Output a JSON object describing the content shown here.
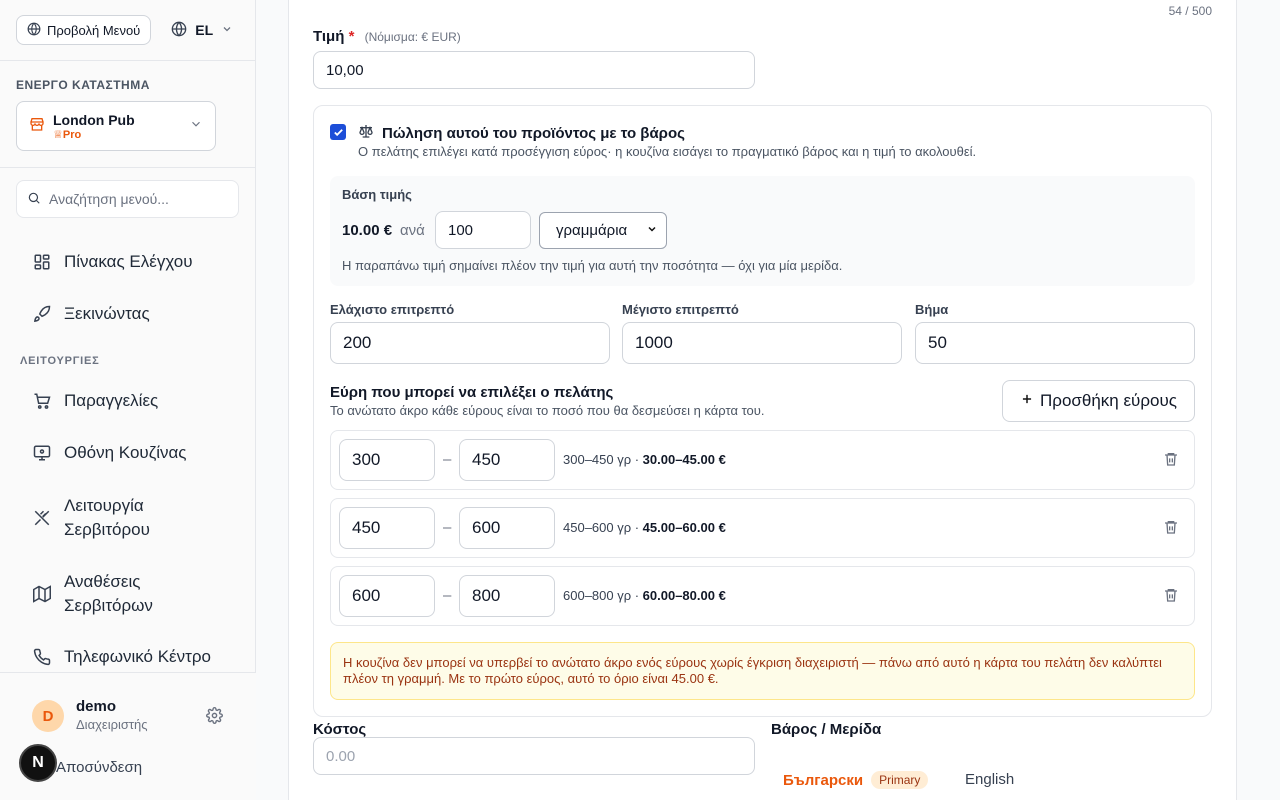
{
  "sidebar": {
    "menu_view_label": "Προβολή Μενού",
    "lang_code": "EL",
    "store_section_label": "ΕΝΕΡΓΟ ΚΑΤΑΣΤΗΜΑ",
    "store_name": "London Pub",
    "store_plan": "Pro",
    "search_placeholder": "Αναζήτηση μενού...",
    "nav": {
      "dashboard": "Πίνακας Ελέγχου",
      "getting_started": "Ξεκινώντας",
      "section_features": "ΛΕΙΤΟΥΡΓΙΕΣ",
      "orders": "Παραγγελίες",
      "kitchen_screen": "Οθόνη Κουζίνας",
      "waiter_mode": "Λειτουργία Σερβιτόρου",
      "waiter_assignments": "Αναθέσεις Σερβιτόρων",
      "call_center": "Τηλεφωνικό Κέντρο"
    },
    "user": {
      "initial": "D",
      "name": "demo",
      "role": "Διαχειριστής",
      "logout": "Αποσύνδεση"
    },
    "badge_letter": "N"
  },
  "main": {
    "char_counter": "54 / 500",
    "price": {
      "label": "Τιμή",
      "required_mark": "*",
      "currency_hint": "(Νόμισμα: € EUR)",
      "value": "10,00"
    },
    "weight": {
      "checked": true,
      "title": "Πώληση αυτού του προϊόντος με το βάρος",
      "description": "Ο πελάτης επιλέγει κατά προσέγγιση εύρος· η κουζίνα εισάγει το πραγματικό βάρος και η τιμή το ακολουθεί.",
      "basis": {
        "label": "Βάση τιμής",
        "price": "10.00 €",
        "per": "ανά",
        "quantity": "100",
        "unit": "γραμμάρια",
        "note": "Η παραπάνω τιμή σημαίνει πλέον την τιμή για αυτή την ποσότητα — όχι για μία μερίδα."
      },
      "fields": {
        "min_label": "Ελάχιστο επιτρεπτό",
        "min_value": "200",
        "max_label": "Μέγιστο επιτρεπτό",
        "max_value": "1000",
        "step_label": "Βήμα",
        "step_value": "50"
      },
      "ranges_title": "Εύρη που μπορεί να επιλέξει ο πελάτης",
      "ranges_subtitle": "Το ανώτατο άκρο κάθε εύρους είναι το ποσό που θα δεσμεύσει η κάρτα του.",
      "add_range_label": "Προσθήκη εύρους",
      "range_dash": "–",
      "ranges": [
        {
          "from": "300",
          "to": "450",
          "info": "300–450 γρ · ",
          "price": "30.00–45.00 €"
        },
        {
          "from": "450",
          "to": "600",
          "info": "450–600 γρ · ",
          "price": "45.00–60.00 €"
        },
        {
          "from": "600",
          "to": "800",
          "info": "600–800 γρ · ",
          "price": "60.00–80.00 €"
        }
      ],
      "warning": "Η κουζίνα δεν μπορεί να υπερβεί το ανώτατο άκρο ενός εύρους χωρίς έγκριση διαχειριστή — πάνω από αυτό η κάρτα του πελάτη δεν καλύπτει πλέον τη γραμμή. Με το πρώτο εύρος, αυτό το όριο είναι 45.00 €."
    },
    "cost": {
      "label": "Κόστος",
      "placeholder": "0.00"
    },
    "weight_portion": {
      "label": "Βάρος / Μερίδα",
      "tab_primary": "Български",
      "primary_badge": "Primary",
      "tab_secondary": "English"
    }
  },
  "colors": {
    "accent": "#ea580c",
    "checkbox": "#1d4ed8",
    "warning_bg": "#fefce8",
    "warning_text": "#9a3412"
  }
}
